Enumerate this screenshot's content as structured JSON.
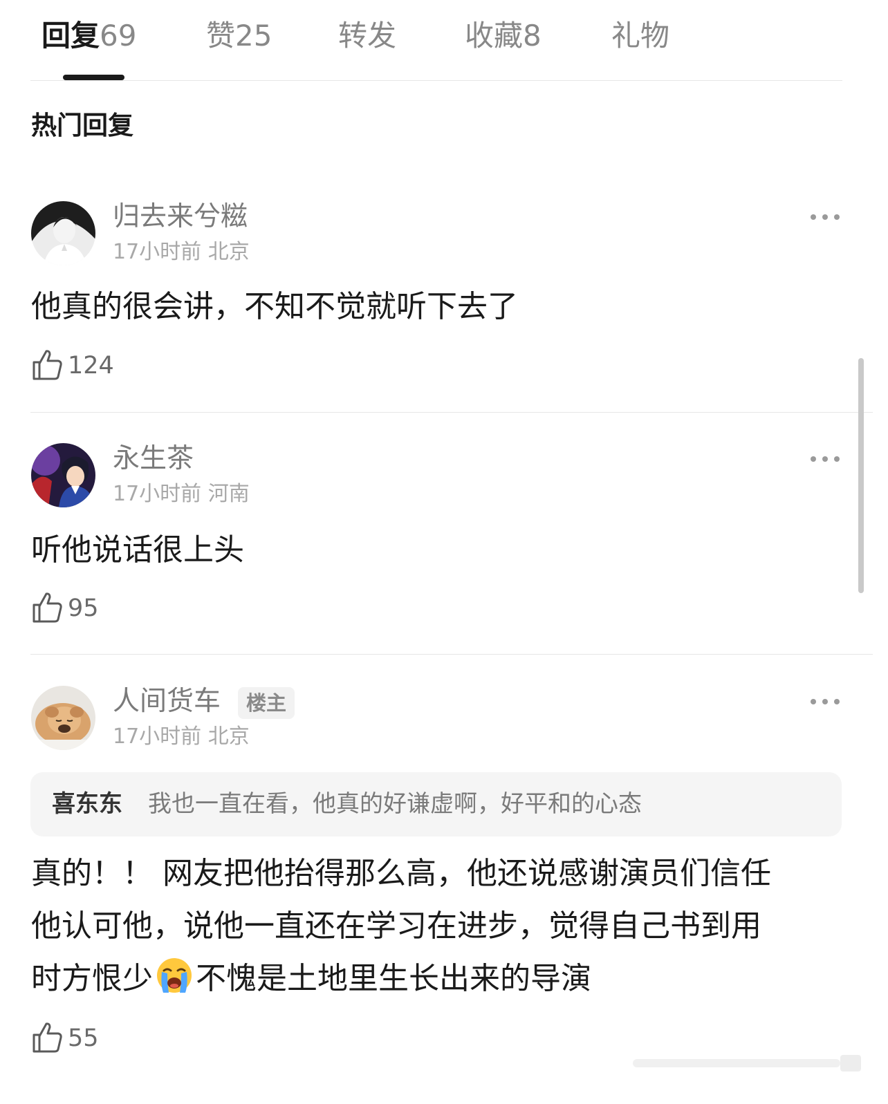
{
  "tabs": [
    {
      "label": "回复",
      "count": "69",
      "active": true
    },
    {
      "label": "赞",
      "count": "25",
      "active": false
    },
    {
      "label": "转发",
      "count": "",
      "active": false
    },
    {
      "label": "收藏",
      "count": "8",
      "active": false
    },
    {
      "label": "礼物",
      "count": "",
      "active": false
    }
  ],
  "section_title": "热门回复",
  "comments": [
    {
      "username": "归去来兮糍",
      "time": "17小时前",
      "location": "北京",
      "text": "他真的很会讲，不知不觉就听下去了",
      "likes": "124",
      "avatar_icon": "avatar-woman-bw"
    },
    {
      "username": "永生茶",
      "time": "17小时前",
      "location": "河南",
      "text": "听他说话很上头",
      "likes": "95",
      "avatar_icon": "avatar-anime"
    },
    {
      "username": "人间货车",
      "badge": "楼主",
      "time": "17小时前",
      "location": "北京",
      "quote": {
        "user": "喜东东",
        "text": "我也一直在看，他真的好谦虚啊，好平和的心态"
      },
      "text_line1": "真的！！ 网友把他抬得那么高，他还说感谢演员们信任",
      "text_line2": "他认可他，说他一直还在学习在进步，觉得自己书到用",
      "text_line3_a": "时方恨少",
      "text_line3_b": "不愧是土地里生长出来的导演",
      "emoji_icon": "loudly-crying-face-icon",
      "likes": "55",
      "avatar_icon": "avatar-puppy"
    }
  ],
  "colors": {
    "text_primary": "#1a1a1a",
    "text_secondary": "#7a7a7a",
    "text_meta": "#a8a8a8",
    "divider": "#e6e6e6",
    "quote_bg": "#f5f5f5"
  }
}
